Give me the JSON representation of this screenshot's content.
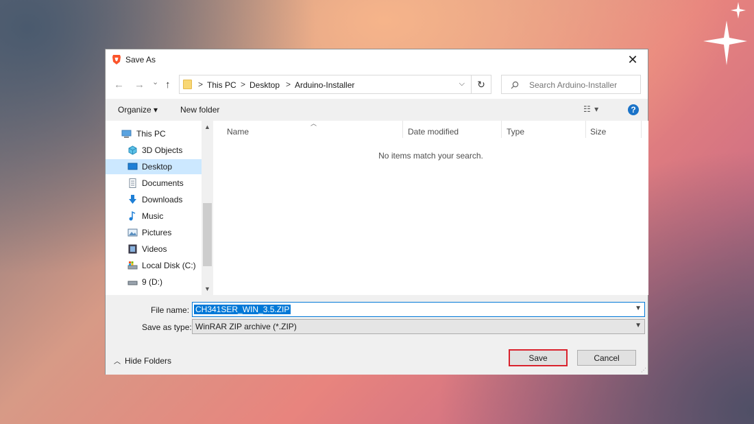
{
  "dialog": {
    "title": "Save As",
    "close_glyph": "✕"
  },
  "nav": {
    "back_glyph": "←",
    "forward_glyph": "→",
    "recent_glyph": "⌄",
    "up_glyph": "↑",
    "refresh_glyph": "↻"
  },
  "address": {
    "crumbs": [
      "This PC",
      "Desktop",
      "Arduino-Installer"
    ],
    "separator": ">",
    "dropdown_glyph": "⌵"
  },
  "search": {
    "placeholder": "Search Arduino-Installer"
  },
  "toolbar": {
    "organize_label": "Organize ▾",
    "new_folder_label": "New folder",
    "view_glyph": "☷ ▾",
    "help_glyph": "?"
  },
  "sidebar": {
    "items": [
      {
        "label": "This PC",
        "icon": "computer-icon"
      },
      {
        "label": "3D Objects",
        "icon": "cube-icon"
      },
      {
        "label": "Desktop",
        "icon": "desktop-icon"
      },
      {
        "label": "Documents",
        "icon": "document-icon"
      },
      {
        "label": "Downloads",
        "icon": "download-icon"
      },
      {
        "label": "Music",
        "icon": "music-icon"
      },
      {
        "label": "Pictures",
        "icon": "pictures-icon"
      },
      {
        "label": "Videos",
        "icon": "video-icon"
      },
      {
        "label": "Local Disk (C:)",
        "icon": "disk-icon"
      },
      {
        "label": "9 (D:)",
        "icon": "drive-icon"
      }
    ],
    "selected": "Desktop"
  },
  "file_list": {
    "columns": [
      "Name",
      "Date modified",
      "Type",
      "Size"
    ],
    "empty_message": "No items match your search."
  },
  "form": {
    "file_name_label": "File name:",
    "file_name_value": "CH341SER_WIN_3.5.ZIP",
    "save_type_label": "Save as type:",
    "save_type_value": "WinRAR ZIP archive (*.ZIP)",
    "hide_folders_label": "Hide Folders",
    "save_label": "Save",
    "cancel_label": "Cancel"
  },
  "colors": {
    "selection": "#0078d7",
    "nav_selected": "#cce8ff",
    "highlight_border": "#d9212c",
    "help_blue": "#1a73c8"
  }
}
